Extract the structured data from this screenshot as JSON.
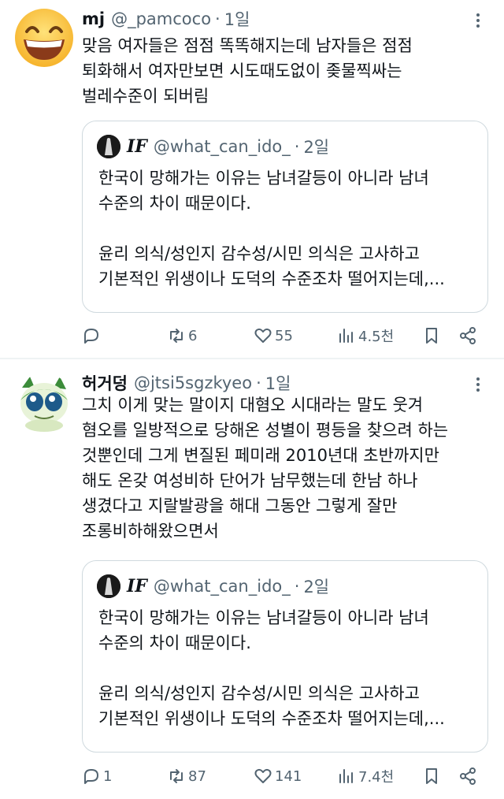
{
  "tweets": [
    {
      "display_name": "mj",
      "handle": "@_pamcoco",
      "separator": "·",
      "time": "1일",
      "avatar_icon": "grinning-smile-emoji",
      "text_lines": [
        "맞음 여자들은 점점 똑똑해지는데 남자들은 점점",
        "퇴화해서 여자만보면 시도때도없이 좆물찍싸는",
        "벌레수준이 되버림"
      ],
      "quote": {
        "name": "IF",
        "handle": "@what_can_ido_",
        "separator": "·",
        "time": "2일",
        "text_lines": [
          "한국이 망해가는 이유는 남녀갈등이 아니라 남녀",
          "수준의 차이 때문이다.",
          "",
          "윤리 의식/성인지 감수성/시민 의식은 고사하고",
          "기본적인 위생이나 도덕의 수준조차 떨어지는데,..."
        ]
      },
      "actions": {
        "reply": "",
        "retweet": "6",
        "like": "55",
        "views": "4.5천"
      }
    },
    {
      "display_name": "허거덩",
      "handle": "@jtsi5sgzkyeo",
      "separator": "·",
      "time": "1일",
      "avatar_icon": "green-cartoon-creature",
      "text_lines": [
        "그치 이게 맞는 말이지 대혐오 시대라는 말도 웃겨",
        "혐오를 일방적으로 당해온 성별이 평등을 찾으려 하는",
        "것뿐인데 그게 변질된 페미래 2010년대 초반까지만",
        "해도 온갖 여성비하 단어가 남무했는데 한남 하나",
        "생겼다고 지랄발광을 해대 그동안 그렇게 잘만",
        "조롱비하해왔으면서"
      ],
      "quote": {
        "name": "IF",
        "handle": "@what_can_ido_",
        "separator": "·",
        "time": "2일",
        "text_lines": [
          "한국이 망해가는 이유는 남녀갈등이 아니라 남녀",
          "수준의 차이 때문이다.",
          "",
          "윤리 의식/성인지 감수성/시민 의식은 고사하고",
          "기본적인 위생이나 도덕의 수준조차 떨어지는데,..."
        ]
      },
      "actions": {
        "reply": "1",
        "retweet": "87",
        "like": "141",
        "views": "7.4천"
      }
    }
  ],
  "icons": {
    "more": "more-dots-icon",
    "reply": "reply-bubble-icon",
    "retweet": "retweet-arrows-icon",
    "like": "heart-icon",
    "views": "views-bar-chart-icon",
    "bookmark": "bookmark-icon",
    "share": "share-icon"
  },
  "colors": {
    "text_primary": "#0f1419",
    "text_secondary": "#536471",
    "border": "#cfd9de",
    "divider": "#eff3f4"
  }
}
